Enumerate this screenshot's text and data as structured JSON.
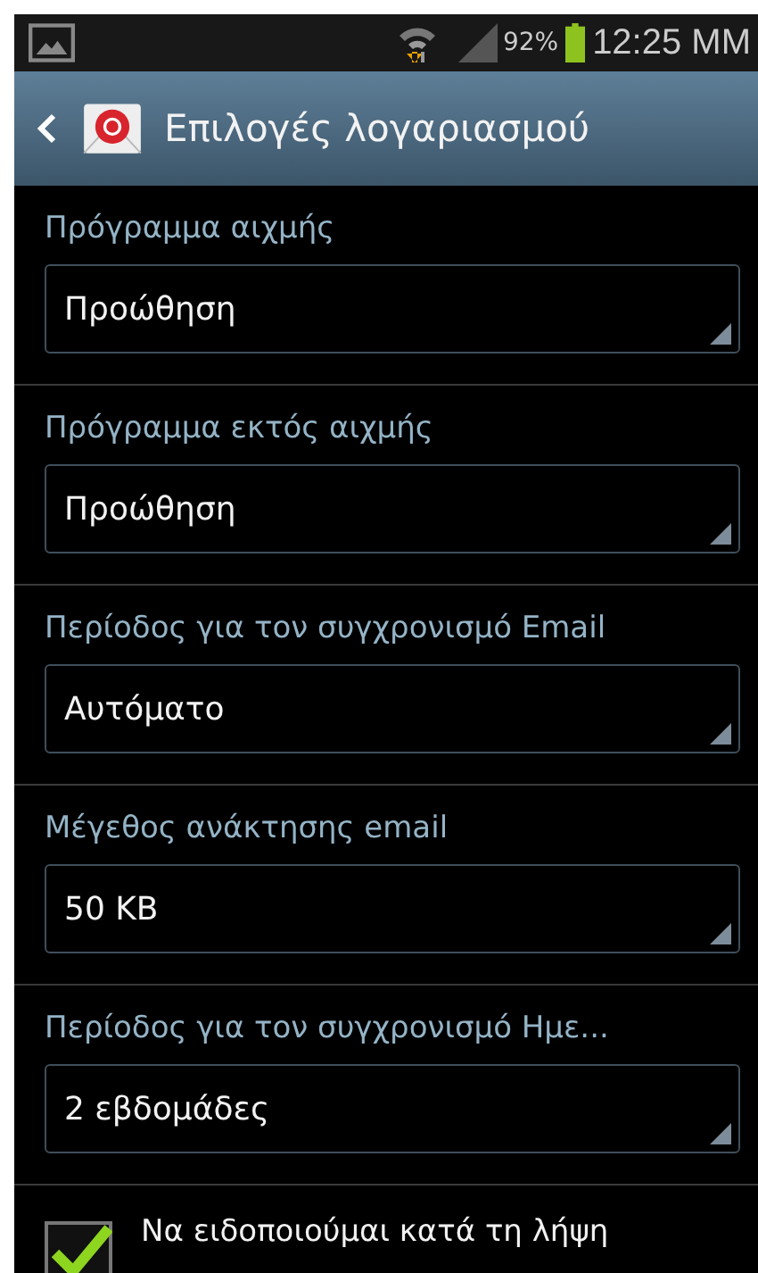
{
  "status_bar": {
    "battery": "92%",
    "time": "12:25 MM"
  },
  "action_bar": {
    "title": "Επιλογές λογαριασμού"
  },
  "settings": [
    {
      "kind": "dropdown",
      "label": "Πρόγραμμα αιχμής",
      "value": "Προώθηση"
    },
    {
      "kind": "dropdown",
      "label": "Πρόγραμμα εκτός αιχμής",
      "value": "Προώθηση"
    },
    {
      "kind": "dropdown",
      "label": "Περίοδος για τον συγχρονισμό Email",
      "value": "Αυτόματο"
    },
    {
      "kind": "dropdown",
      "label": "Μέγεθος ανάκτησης email",
      "value": "50 KB"
    },
    {
      "kind": "dropdown",
      "label": "Περίοδος για τον συγχρονισμό Ημε...",
      "value": "2 εβδομάδες"
    },
    {
      "kind": "checkbox",
      "label": "Να ειδοποιούμαι κατά τη λήψη",
      "checked": true
    }
  ]
}
